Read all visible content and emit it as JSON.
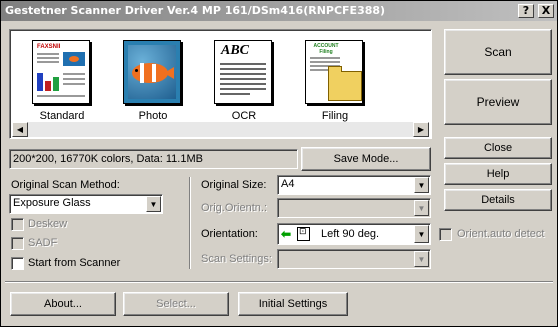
{
  "window": {
    "title": "Gestetner Scanner Driver Ver.4 MP 161/DSm416(RNPCFE388)",
    "help_btn": "?",
    "close_btn": "X"
  },
  "presets": [
    {
      "label": "Standard",
      "icon": "standard-doc-icon"
    },
    {
      "label": "Photo",
      "icon": "photo-fish-icon"
    },
    {
      "label": "OCR",
      "icon": "ocr-abc-icon"
    },
    {
      "label": "Filing",
      "icon": "filing-folder-icon"
    }
  ],
  "thumb_text": {
    "fax_logo": "FAXSNII",
    "ocr": "ABC",
    "filing": "ACCOUNT Filing"
  },
  "status": {
    "info": "200*200, 16770K colors, Data: 11.1MB",
    "save_mode": "Save Mode..."
  },
  "right_buttons": {
    "scan": "Scan",
    "preview": "Preview",
    "close": "Close",
    "help": "Help",
    "details": "Details",
    "orient_auto": "Orient.auto detect"
  },
  "left": {
    "scan_method_label": "Original Scan Method:",
    "scan_method_value": "Exposure Glass",
    "deskew": "Deskew",
    "sadf": "SADF",
    "start_from_scanner": "Start from Scanner"
  },
  "middle": {
    "size_label": "Original Size:",
    "size_value": "A4",
    "orig_orient_label": "Orig.Orientn.:",
    "orientation_label": "Orientation:",
    "orientation_value": "Left 90 deg.",
    "scan_settings_label": "Scan Settings:"
  },
  "bottom": {
    "about": "About...",
    "select": "Select...",
    "initial": "Initial Settings"
  },
  "colors": {
    "title_start": "#808080",
    "title_end": "#c0c0c0",
    "face": "#d4d0c8",
    "disabled_text": "#808080",
    "fish_orange": "#f07020",
    "water_blue": "#2a7fb0",
    "folder_yellow": "#f0d060"
  }
}
